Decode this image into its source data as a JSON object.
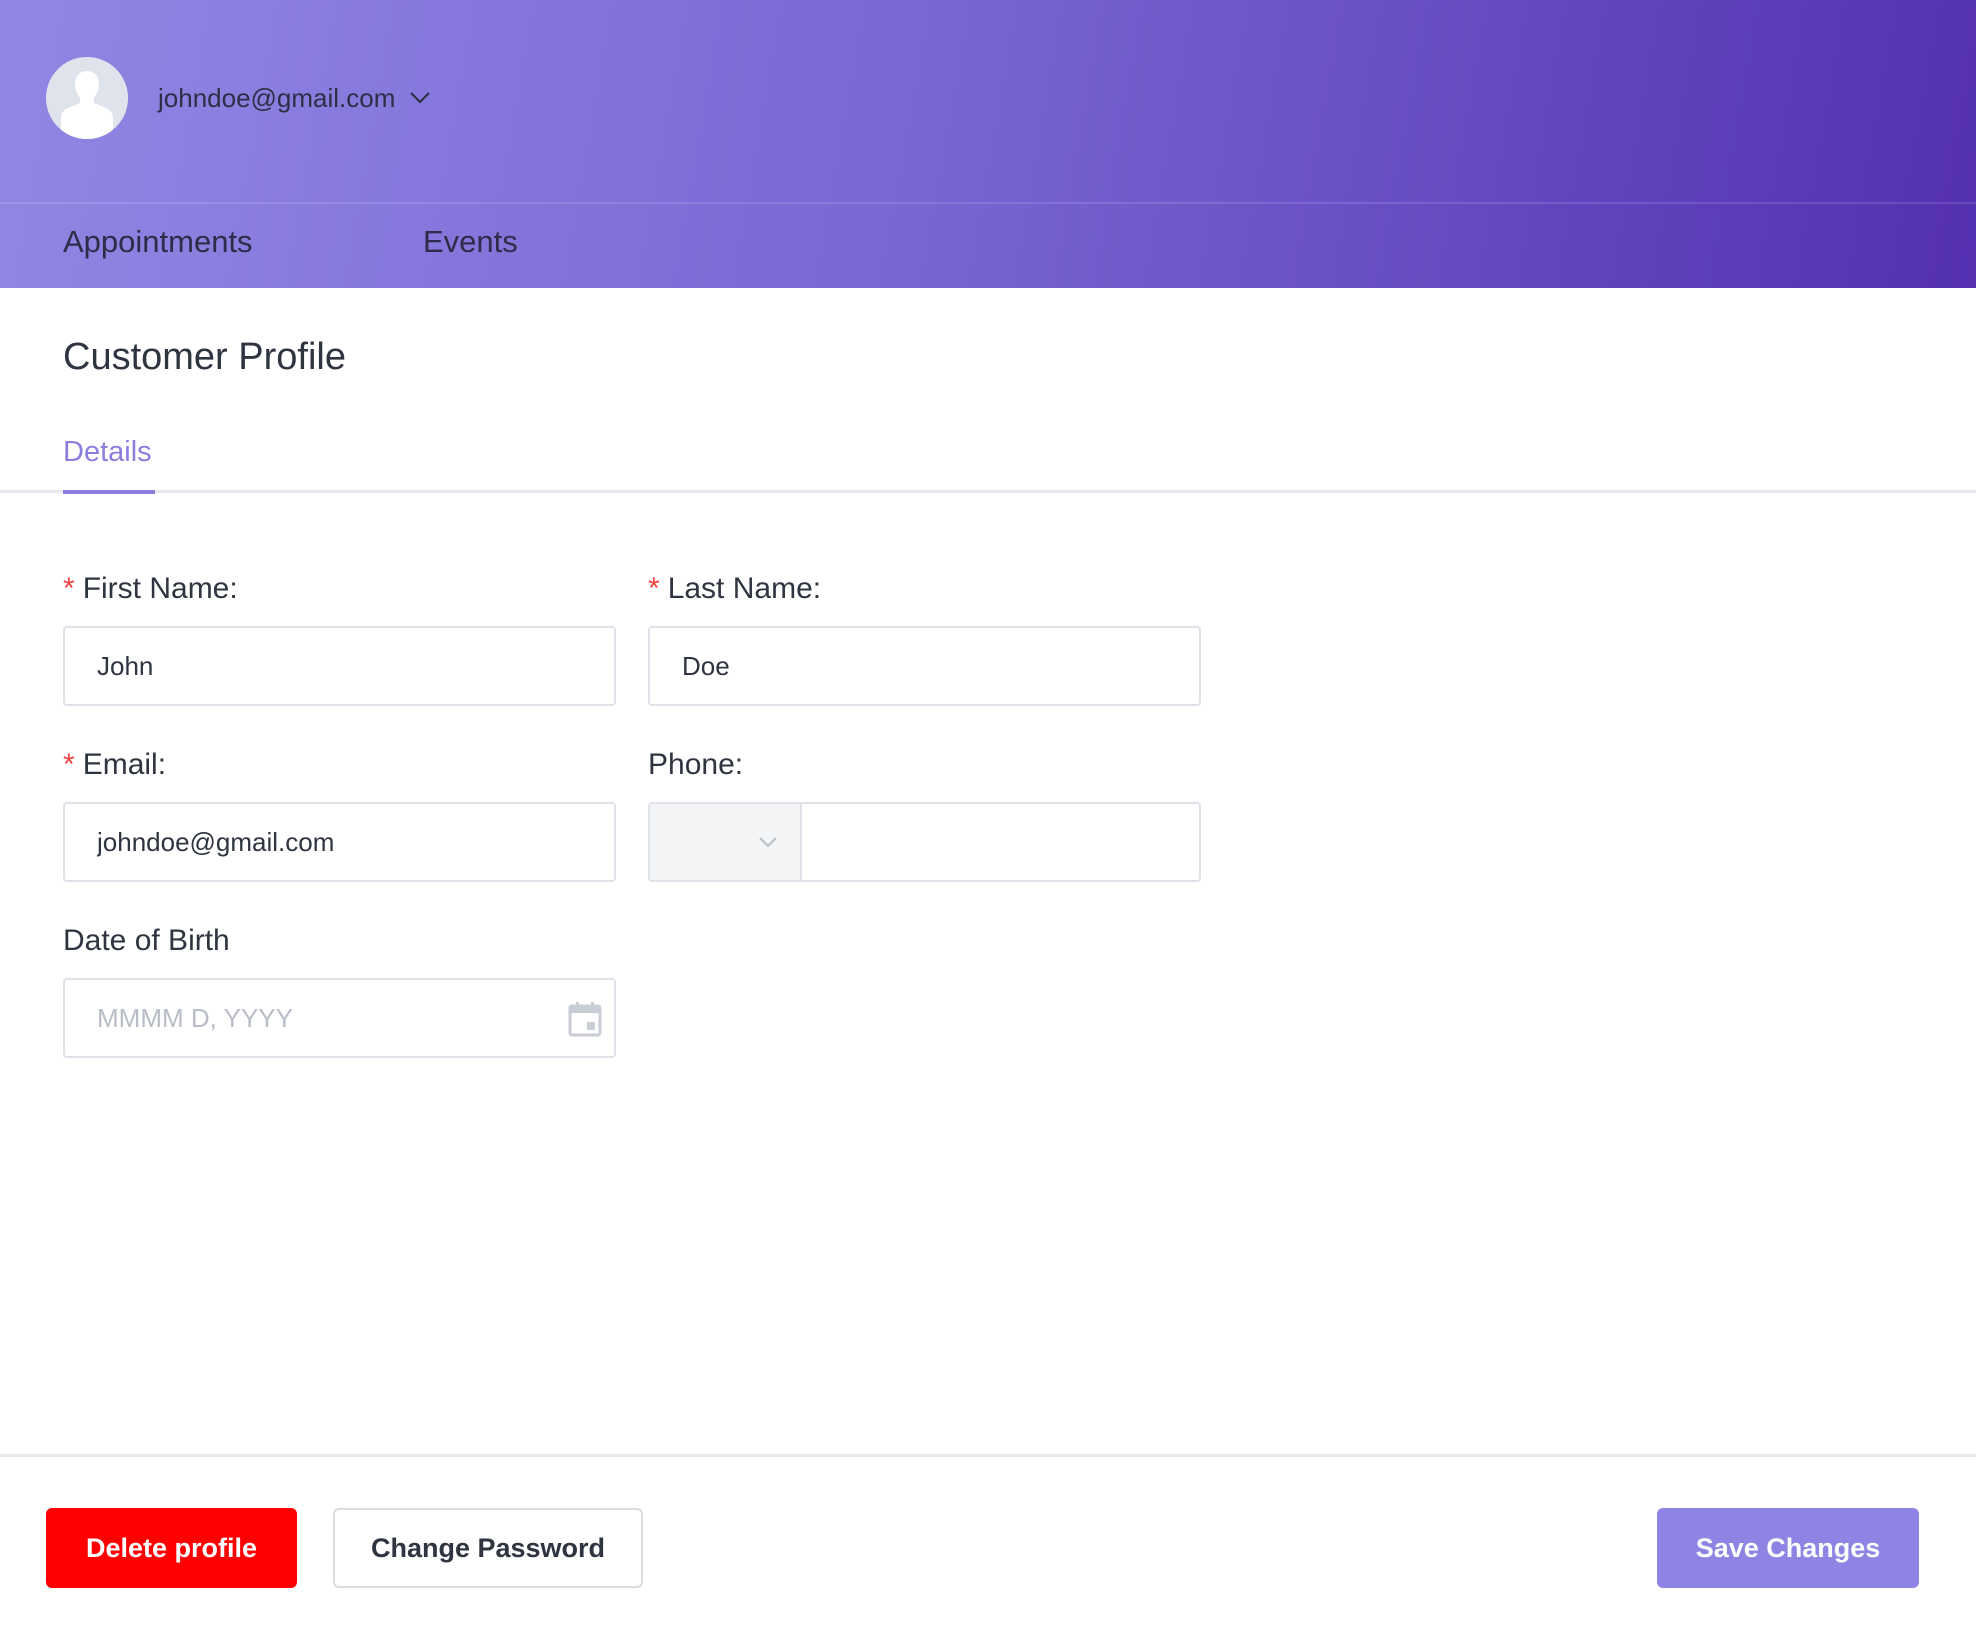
{
  "header": {
    "user_email": "johndoe@gmail.com",
    "avatar_icon": "user-avatar-icon",
    "dropdown_icon": "chevron-down-icon"
  },
  "nav": {
    "items": [
      {
        "label": "Appointments"
      },
      {
        "label": "Events"
      }
    ]
  },
  "page": {
    "title": "Customer Profile",
    "tabs": [
      {
        "label": "Details",
        "active": true
      }
    ]
  },
  "form": {
    "first_name": {
      "label": "First Name:",
      "required": true,
      "value": "John"
    },
    "last_name": {
      "label": "Last Name:",
      "required": true,
      "value": "Doe"
    },
    "email": {
      "label": "Email:",
      "required": true,
      "value": "johndoe@gmail.com"
    },
    "phone": {
      "label": "Phone:",
      "required": false,
      "country_code": "",
      "value": ""
    },
    "dob": {
      "label": "Date of Birth",
      "required": false,
      "value": "",
      "placeholder": "MMMM D, YYYY"
    },
    "required_marker": "*"
  },
  "footer": {
    "delete_label": "Delete profile",
    "change_password_label": "Change Password",
    "save_label": "Save Changes"
  },
  "colors": {
    "accent": "#8b7fdd",
    "danger": "#ff0000",
    "header_gradient_start": "#9187e3",
    "header_gradient_end": "#5430b1"
  }
}
